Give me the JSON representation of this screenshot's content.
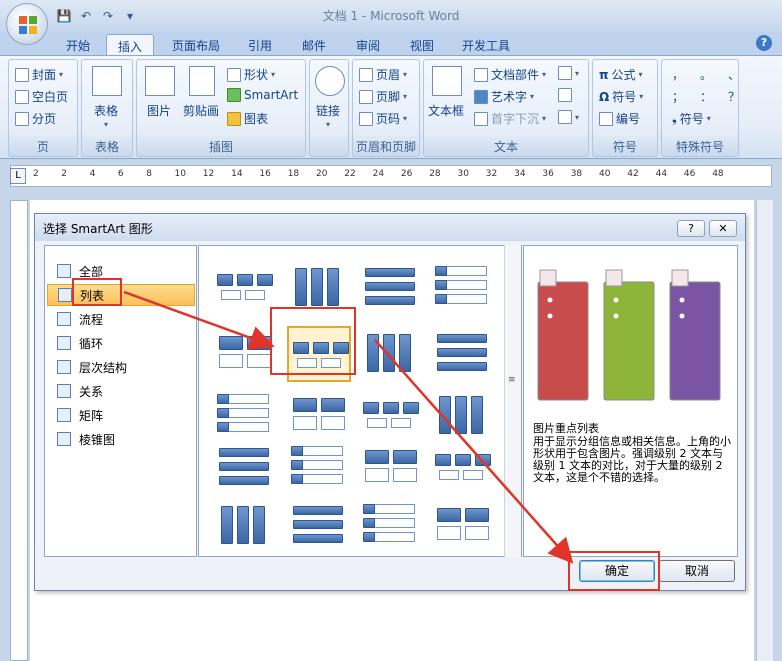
{
  "window": {
    "title": "文档 1 - Microsoft Word"
  },
  "qat": {
    "save": "💾",
    "undo": "↶",
    "redo": "↷",
    "more": "▾"
  },
  "tabs": [
    "开始",
    "插入",
    "页面布局",
    "引用",
    "邮件",
    "审阅",
    "视图",
    "开发工具"
  ],
  "active_tab": "插入",
  "help": "?",
  "ribbon": {
    "pages": {
      "items": [
        "封面",
        "空白页",
        "分页"
      ],
      "label": "页"
    },
    "tables": {
      "button": "表格",
      "label": "表格"
    },
    "illustrations": {
      "picture": "图片",
      "clipart": "剪贴画",
      "shapes": "形状",
      "smartart": "SmartArt",
      "chart": "图表",
      "label": "插图"
    },
    "links": {
      "button": "链接"
    },
    "header_footer": {
      "items": [
        "页眉",
        "页脚",
        "页码"
      ],
      "label": "页眉和页脚"
    },
    "text": {
      "textbox": "文本框",
      "quickparts": "文档部件",
      "wordart": "艺术字",
      "dropcap": "首字下沉",
      "label": "文本"
    },
    "symbols": {
      "equation": "公式",
      "symbol": "符号",
      "number": "编号",
      "label": "符号"
    },
    "special": {
      "row1": [
        "，",
        "。",
        "、"
      ],
      "row2": [
        "；",
        "：",
        "？"
      ],
      "symbol": "符号",
      "label": "特殊符号"
    }
  },
  "ruler": {
    "corner": "L",
    "ticks": [
      "2",
      "2",
      "4",
      "6",
      "8",
      "10",
      "12",
      "14",
      "16",
      "18",
      "20",
      "22",
      "24",
      "26",
      "28",
      "30",
      "32",
      "34",
      "36",
      "38",
      "40",
      "42",
      "44",
      "46",
      "48"
    ]
  },
  "dialog": {
    "title": "选择 SmartArt 图形",
    "help": "?",
    "close": "✕",
    "categories": [
      "全部",
      "列表",
      "流程",
      "循环",
      "层次结构",
      "关系",
      "矩阵",
      "棱锥图"
    ],
    "selected_category": "列表",
    "preview": {
      "title": "图片重点列表",
      "description": "用于显示分组信息或相关信息。上角的小形状用于包含图片。强调级别 2 文本与级别 1 文本的对比，对于大量的级别 2 文本，这是个不错的选择。",
      "colors": [
        "#c94c4c",
        "#8fb43a",
        "#7b55a4"
      ]
    },
    "ok": "确定",
    "cancel": "取消"
  }
}
